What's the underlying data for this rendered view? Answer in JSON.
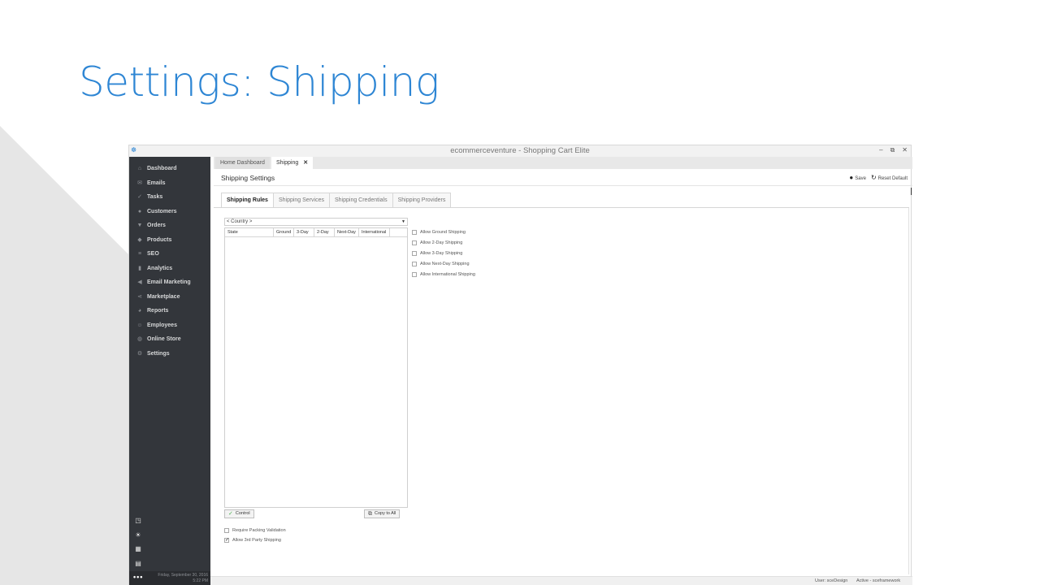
{
  "slide": {
    "title": "Settings: Shipping"
  },
  "window": {
    "title": "ecommerceventure - Shopping Cart Elite",
    "controls": [
      "–",
      "⧉",
      "✕"
    ]
  },
  "sidebar": {
    "items": [
      {
        "label": "Dashboard",
        "icon": "home-icon"
      },
      {
        "label": "Emails",
        "icon": "envelope-icon"
      },
      {
        "label": "Tasks",
        "icon": "checkmarks-icon"
      },
      {
        "label": "Customers",
        "icon": "person-icon"
      },
      {
        "label": "Orders",
        "icon": "cart-icon"
      },
      {
        "label": "Products",
        "icon": "tag-icon"
      },
      {
        "label": "SEO",
        "icon": "sliders-icon"
      },
      {
        "label": "Analytics",
        "icon": "bar-chart-icon"
      },
      {
        "label": "Email Marketing",
        "icon": "megaphone-icon"
      },
      {
        "label": "Marketplace",
        "icon": "share-icon"
      },
      {
        "label": "Reports",
        "icon": "pie-chart-icon"
      },
      {
        "label": "Employees",
        "icon": "team-icon"
      },
      {
        "label": "Online Store",
        "icon": "globe-icon"
      },
      {
        "label": "Settings",
        "icon": "gear-search-icon"
      }
    ],
    "footer": {
      "more": "•••",
      "date": "Friday, September 30, 2016",
      "time": "5:22 PM"
    }
  },
  "doc_tabs": [
    {
      "label": "Home Dashboard"
    },
    {
      "label": "Shipping",
      "close": "✕"
    }
  ],
  "header": {
    "title": "Shipping Settings",
    "save_label": "Save",
    "reset_label": "Reset Default"
  },
  "sub_tabs": [
    "Shipping Rules",
    "Shipping Services",
    "Shipping Credentials",
    "Shipping Providers"
  ],
  "rules": {
    "country_placeholder": "< Country >",
    "columns": [
      "State",
      "Ground",
      "3-Day",
      "2-Day",
      "Next-Day",
      "International"
    ],
    "control_button": "Control",
    "copy_button": "Copy to All",
    "allow_options": [
      {
        "label": "Allow Ground Shipping",
        "checked": false
      },
      {
        "label": "Allow 2-Day Shipping",
        "checked": false
      },
      {
        "label": "Allow 3-Day Shipping",
        "checked": false
      },
      {
        "label": "Allow Next-Day Shipping",
        "checked": false
      },
      {
        "label": "Allow International Shipping",
        "checked": false
      }
    ],
    "bottom_options": [
      {
        "label": "Require Packing Validation",
        "checked": false
      },
      {
        "label": "Allow 3rd Party Shipping",
        "checked": true,
        "mark": "✓"
      }
    ]
  },
  "status": {
    "user": "User: sceDesign",
    "mode": "Active - sceframework"
  }
}
